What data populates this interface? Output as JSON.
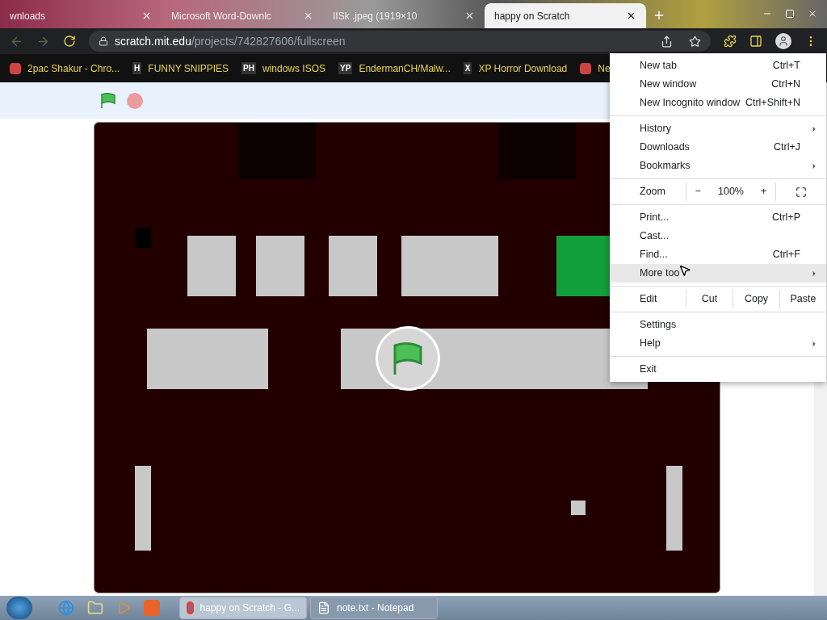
{
  "tabs": [
    {
      "title": "wnloads",
      "selected": false
    },
    {
      "title": "Microsoft Word-Downlc",
      "selected": false
    },
    {
      "title": "IISk  .jpeg (1919×10",
      "selected": false
    },
    {
      "title": "happy on Scratch",
      "selected": true
    }
  ],
  "address": {
    "host": "scratch.mit.edu",
    "path": "/projects/742827606/fullscreen"
  },
  "bookmarks": [
    {
      "title": "2pac Shakur - Chro..."
    },
    {
      "title": "FUNNY SNIPPIES",
      "badge": "H"
    },
    {
      "title": "windows ISOS",
      "badge": "PH"
    },
    {
      "title": "EndermanCH/Malw...",
      "badge": "YP"
    },
    {
      "title": "XP Horror Download",
      "badge": "X"
    },
    {
      "title": "Ne"
    }
  ],
  "menu": {
    "groups": [
      [
        {
          "label": "New tab",
          "shortcut": "Ctrl+T",
          "submenu": false,
          "selected": false
        },
        {
          "label": "New window",
          "shortcut": "Ctrl+N",
          "submenu": false,
          "selected": false
        },
        {
          "label": "New Incognito window",
          "shortcut": "Ctrl+Shift+N",
          "submenu": false,
          "selected": false
        }
      ],
      [
        {
          "label": "History",
          "submenu": true,
          "selected": false
        },
        {
          "label": "Downloads",
          "shortcut": "Ctrl+J",
          "submenu": false,
          "selected": false
        },
        {
          "label": "Bookmarks",
          "submenu": true,
          "selected": false
        }
      ],
      [
        {
          "label": "Print...",
          "shortcut": "Ctrl+P",
          "submenu": false,
          "selected": false
        },
        {
          "label": "Cast...",
          "submenu": false,
          "selected": false
        },
        {
          "label": "Find...",
          "shortcut": "Ctrl+F",
          "submenu": false,
          "selected": false
        },
        {
          "label": "More too",
          "submenu": true,
          "selected": true
        }
      ],
      [
        {
          "label": "Settings",
          "submenu": false,
          "selected": false
        },
        {
          "label": "Help",
          "submenu": true,
          "selected": false
        }
      ],
      [
        {
          "label": "Exit",
          "submenu": false,
          "selected": false
        }
      ]
    ],
    "zoom": {
      "label": "Zoom",
      "minus": "−",
      "value": "100%",
      "plus": "+"
    },
    "edit": {
      "label": "Edit",
      "actions": [
        "Cut",
        "Copy",
        "Paste"
      ]
    }
  },
  "taskbar": [
    {
      "title": "happy on Scratch - G...",
      "selected": true
    },
    {
      "title": "note.txt - Notepad",
      "selected": false
    }
  ]
}
